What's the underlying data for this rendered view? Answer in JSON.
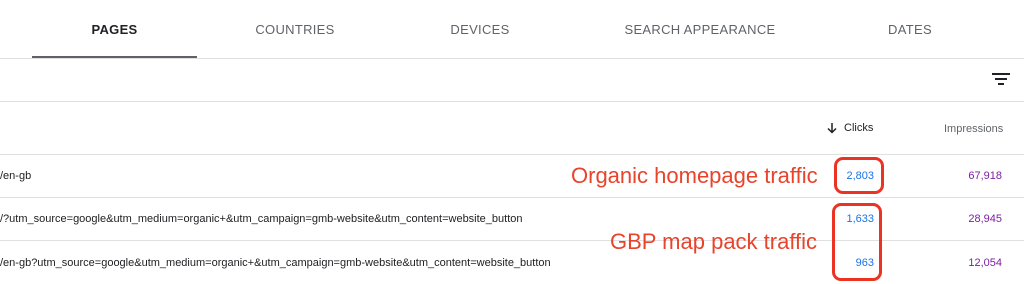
{
  "tabs": [
    {
      "label": "PAGES",
      "active": true
    },
    {
      "label": "COUNTRIES",
      "active": false
    },
    {
      "label": "DEVICES",
      "active": false
    },
    {
      "label": "SEARCH APPEARANCE",
      "active": false
    },
    {
      "label": "DATES",
      "active": false
    }
  ],
  "toolbar": {
    "filter_icon": "filter-icon"
  },
  "table": {
    "columns": {
      "clicks": "Clicks",
      "impressions": "Impressions",
      "sort_icon": "arrow-down-icon"
    },
    "rows": [
      {
        "page": "/en-gb",
        "clicks": "2,803",
        "impressions": "67,918"
      },
      {
        "page": "/?utm_source=google&utm_medium=organic+&utm_campaign=gmb-website&utm_content=website_button",
        "clicks": "1,633",
        "impressions": "28,945"
      },
      {
        "page": "/en-gb?utm_source=google&utm_medium=organic+&utm_campaign=gmb-website&utm_content=website_button",
        "clicks": "963",
        "impressions": "12,054"
      }
    ]
  },
  "annotations": {
    "organic": "Organic homepage traffic",
    "gbp": "GBP map pack traffic"
  },
  "colors": {
    "clicks": "#1a73e8",
    "impressions": "#7b1fa2",
    "annotation": "#e8432b"
  }
}
